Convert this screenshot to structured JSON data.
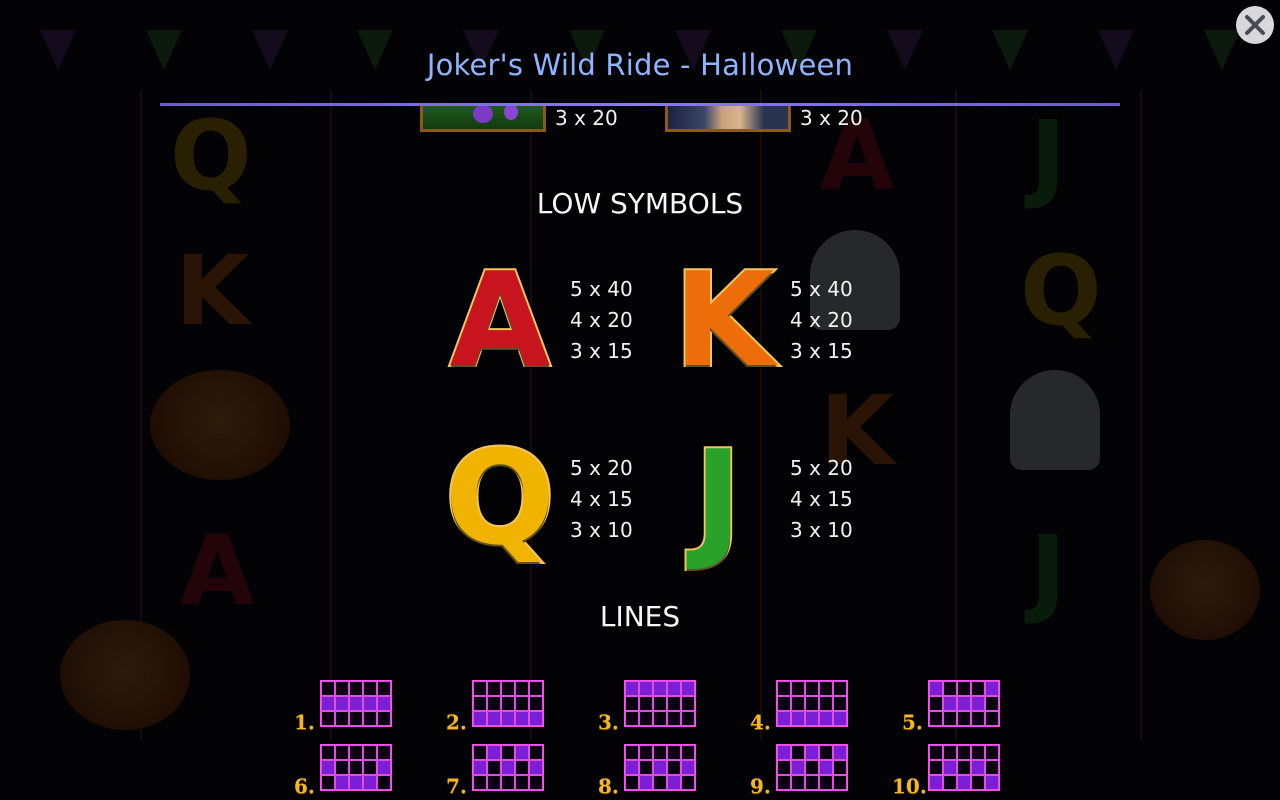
{
  "header": {
    "title": "Joker's Wild Ride - Halloween"
  },
  "high_symbols_cut": [
    {
      "pay": "3 x 20"
    },
    {
      "pay": "3 x 20"
    }
  ],
  "low_symbols": {
    "heading": "LOW SYMBOLS",
    "items": [
      {
        "letter": "A",
        "color": "#c8141e",
        "pays": [
          "5 x 40",
          "4 x 20",
          "3 x 15"
        ]
      },
      {
        "letter": "K",
        "color": "#ec6d0a",
        "pays": [
          "5 x 40",
          "4 x 20",
          "3 x 15"
        ]
      },
      {
        "letter": "Q",
        "color": "#f0b400",
        "pays": [
          "5 x 20",
          "4 x 15",
          "3 x 10"
        ]
      },
      {
        "letter": "J",
        "color": "#2aa12a",
        "pays": [
          "5 x 20",
          "4 x 15",
          "3 x 10"
        ]
      }
    ]
  },
  "lines": {
    "heading": "LINES",
    "items": [
      {
        "label": "1.",
        "rows": [
          1,
          1,
          1,
          1,
          1
        ]
      },
      {
        "label": "2.",
        "rows": [
          2,
          2,
          2,
          2,
          2
        ]
      },
      {
        "label": "3.",
        "rows": [
          0,
          0,
          0,
          0,
          0
        ]
      },
      {
        "label": "4.",
        "rows": [
          2,
          2,
          2,
          2,
          2
        ]
      },
      {
        "label": "5.",
        "rows": [
          0,
          1,
          1,
          1,
          0
        ]
      },
      {
        "label": "6.",
        "rows": [
          1,
          2,
          2,
          2,
          1
        ]
      },
      {
        "label": "7.",
        "rows": [
          1,
          0,
          1,
          0,
          1
        ]
      },
      {
        "label": "8.",
        "rows": [
          1,
          2,
          1,
          2,
          1
        ]
      },
      {
        "label": "9.",
        "rows": [
          0,
          1,
          0,
          1,
          0
        ]
      },
      {
        "label": "10.",
        "rows": [
          2,
          1,
          2,
          1,
          2
        ]
      }
    ]
  },
  "colors": {
    "title": "#8eb4ff",
    "rule": "#7a6cf0",
    "line_active": "#7a1fd6",
    "line_border": "#ff4ff0",
    "line_number": "#f3b821"
  },
  "icons": {
    "close": "close-icon"
  }
}
